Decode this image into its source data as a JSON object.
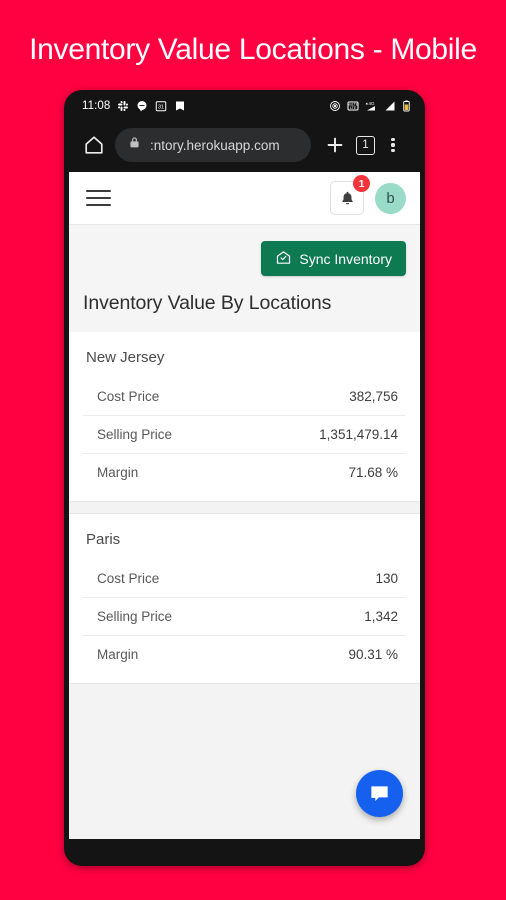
{
  "banner": {
    "title": "Inventory Value Locations - Mobile",
    "background_color": "#FF0040",
    "text_color": "#FFFFFF"
  },
  "status_bar": {
    "time": "11:08",
    "left_icons": [
      "slack-icon",
      "chat-bubble-icon",
      "calendar-31-icon",
      "book-icon"
    ],
    "right_icons": [
      "cast-icon",
      "volte-icon",
      "mobile-data-4g-icon",
      "signal-bars-icon",
      "battery-icon"
    ]
  },
  "browser": {
    "home_icon": "home-icon",
    "lock_icon": "lock-icon",
    "url": ":ntory.herokuapp.com",
    "new_tab_icon": "plus-icon",
    "tab_count": "1",
    "menu_icon": "overflow-menu-icon"
  },
  "app_bar": {
    "menu_icon": "hamburger-menu-icon",
    "notification_icon": "bell-icon",
    "notification_count": "1",
    "avatar_initial": "b",
    "avatar_color": "#9ADBC8",
    "badge_color": "#F5353B"
  },
  "page": {
    "sync_button_label": "Sync Inventory",
    "sync_button_icon": "warehouse-check-icon",
    "sync_button_color": "#0E7A52",
    "title": "Inventory Value By Locations"
  },
  "locations": [
    {
      "name": "New Jersey",
      "rows": [
        {
          "label": "Cost Price",
          "value": "382,756"
        },
        {
          "label": "Selling Price",
          "value": "1,351,479.14"
        },
        {
          "label": "Margin",
          "value": "71.68 %"
        }
      ]
    },
    {
      "name": "Paris",
      "rows": [
        {
          "label": "Cost Price",
          "value": "130"
        },
        {
          "label": "Selling Price",
          "value": "1,342"
        },
        {
          "label": "Margin",
          "value": "90.31 %"
        }
      ]
    }
  ],
  "fab": {
    "icon": "chat-bubble-icon",
    "color": "#1560EF"
  }
}
